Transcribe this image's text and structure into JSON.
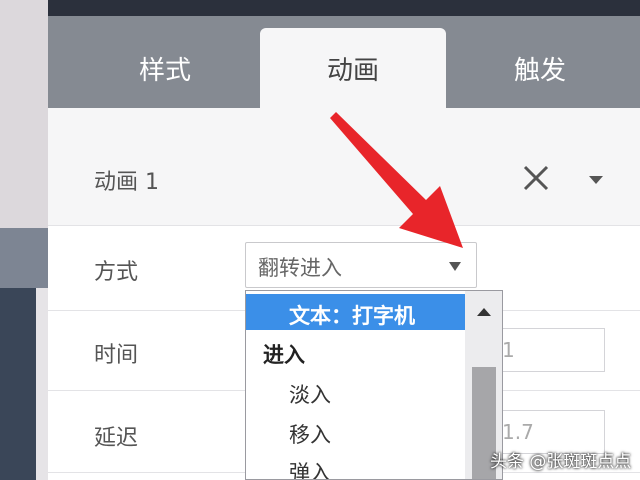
{
  "tabs": {
    "style": "样式",
    "animation": "动画",
    "trigger": "触发"
  },
  "animation_panel": {
    "title": "动画 1",
    "method_label": "方式",
    "method_value": "翻转进入",
    "time_label": "时间",
    "time_value": "1",
    "delay_label": "延迟",
    "delay_value": "1.7"
  },
  "dropdown": {
    "selected": "文本：打字机",
    "group": "进入",
    "items": [
      "淡入",
      "移入",
      "弹入"
    ]
  },
  "watermark": "头条 @张斑斑点点",
  "colors": {
    "tab_bar": "#858a92",
    "selected_option": "#3b8fe8",
    "annotation_arrow": "#e8252a"
  }
}
